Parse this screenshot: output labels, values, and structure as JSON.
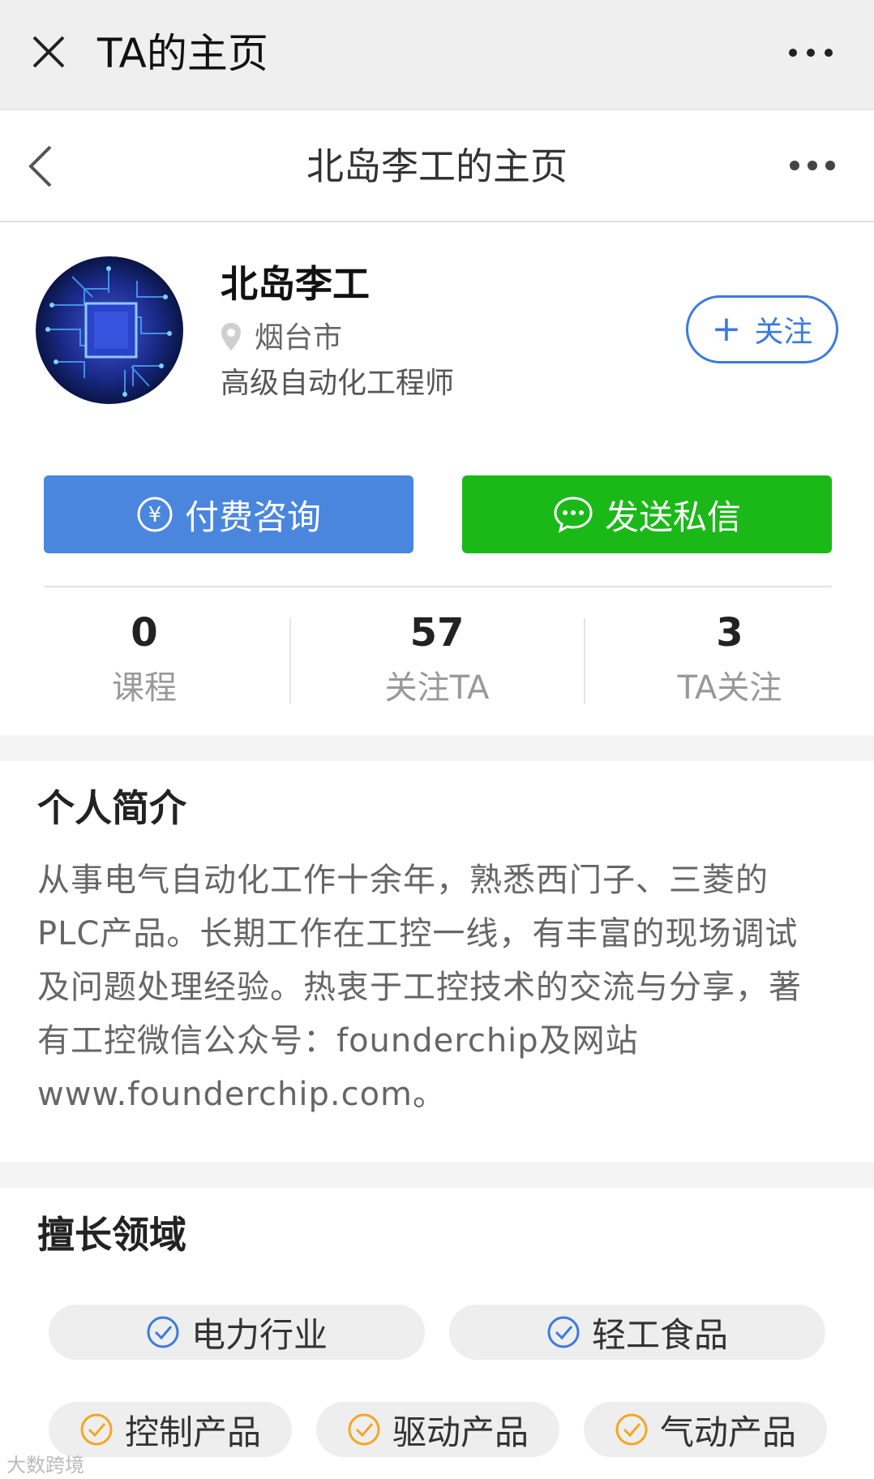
{
  "topbar": {
    "title": "TA的主页"
  },
  "navbar": {
    "title": "北岛李工的主页"
  },
  "profile": {
    "name": "北岛李工",
    "location": "烟台市",
    "job": "高级自动化工程师",
    "follow_label": "关注"
  },
  "actions": {
    "pay_label": "付费咨询",
    "message_label": "发送私信"
  },
  "stats": [
    {
      "value": "0",
      "label": "课程"
    },
    {
      "value": "57",
      "label": "关注TA"
    },
    {
      "value": "3",
      "label": "TA关注"
    }
  ],
  "intro": {
    "title": "个人简介",
    "lines": [
      "从事电气自动化工作十余年，熟悉西门子、三菱的",
      "PLC产品。长期工作在工控一线，有丰富的现场调试",
      "及问题处理经验。热衷于工控技术的交流与分享，著",
      "有工控微信公众号：founderchip及网站",
      "www.founderchip.com。"
    ]
  },
  "expertise": {
    "title": "擅长领域",
    "industries": [
      "电力行业",
      "轻工食品"
    ],
    "products": [
      "控制产品",
      "驱动产品",
      "气动产品"
    ]
  },
  "watermark": "大数跨境",
  "colors": {
    "blue": "#4a86dd",
    "green": "#1ab918",
    "check_blue": "#3b7be0",
    "check_orange": "#f5a623"
  }
}
